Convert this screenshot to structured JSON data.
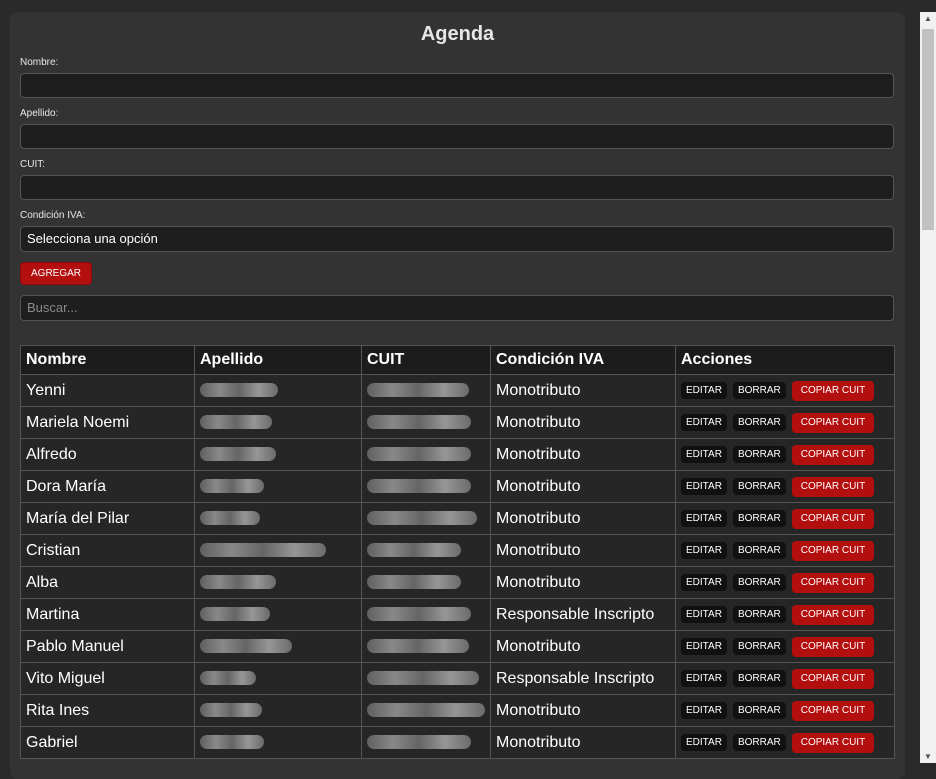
{
  "title": "Agenda",
  "form": {
    "nombre_label": "Nombre:",
    "apellido_label": "Apellido:",
    "cuit_label": "CUIT:",
    "condicion_label": "Condición IVA:",
    "condicion_selected": "Selecciona una opción",
    "add_label": "AGREGAR"
  },
  "search": {
    "placeholder": "Buscar..."
  },
  "table": {
    "headers": [
      "Nombre",
      "Apellido",
      "CUIT",
      "Condición IVA",
      "Acciones"
    ],
    "rows": [
      {
        "nombre": "Yenni",
        "condicion": "Monotributo"
      },
      {
        "nombre": "Mariela Noemi",
        "condicion": "Monotributo"
      },
      {
        "nombre": "Alfredo",
        "condicion": "Monotributo"
      },
      {
        "nombre": "Dora María",
        "condicion": "Monotributo"
      },
      {
        "nombre": "María del Pilar",
        "condicion": "Monotributo"
      },
      {
        "nombre": "Cristian",
        "condicion": "Monotributo"
      },
      {
        "nombre": "Alba",
        "condicion": "Monotributo"
      },
      {
        "nombre": "Martina",
        "condicion": "Responsable Inscripto"
      },
      {
        "nombre": "Pablo Manuel",
        "condicion": "Monotributo"
      },
      {
        "nombre": "Vito Miguel",
        "condicion": "Responsable Inscripto"
      },
      {
        "nombre": "Rita Ines",
        "condicion": "Monotributo"
      },
      {
        "nombre": "Gabriel",
        "condicion": "Monotributo"
      }
    ],
    "actions": {
      "edit": "EDITAR",
      "delete": "BORRAR",
      "copy": "COPIAR CUIT"
    }
  },
  "colors": {
    "accent": "#b30f0f",
    "background": "#333333",
    "field": "#1e1e1e"
  }
}
